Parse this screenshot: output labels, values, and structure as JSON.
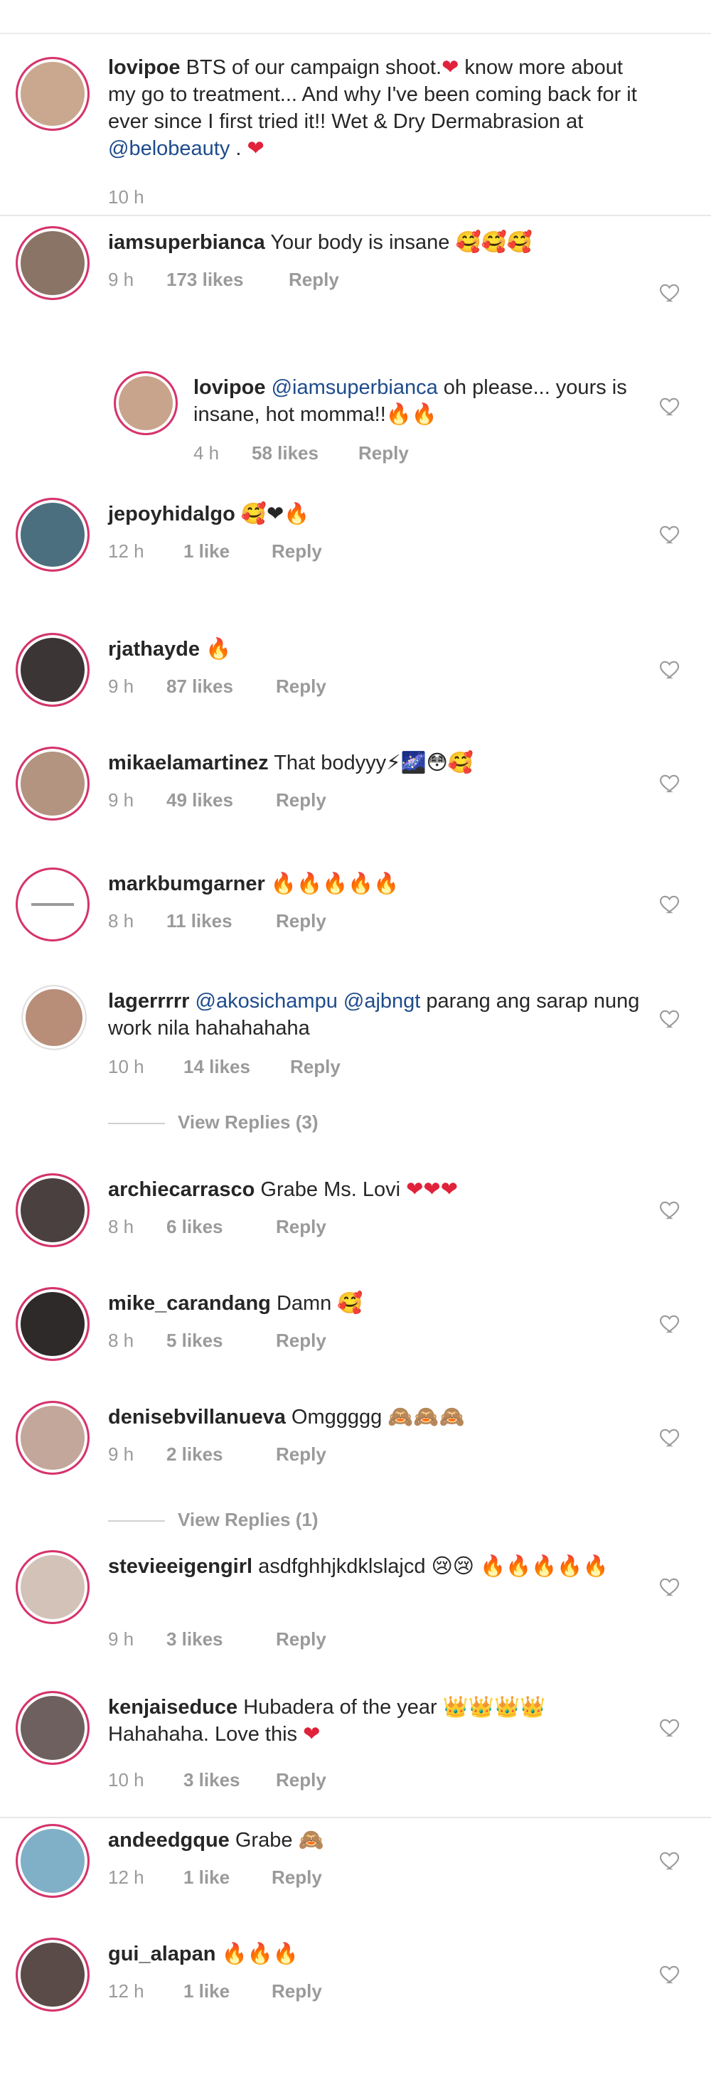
{
  "caption": {
    "username": "lovipoe",
    "text_before": "BTS of our campaign shoot.",
    "text_middle": " know more about my go to treatment... And why I've been coming back for it ever since I first tried it!! Wet & Dry Dermabrasion at ",
    "mention": "@belobeauty",
    "text_after": " . ",
    "time": "10 h",
    "heart": "❤"
  },
  "comments": [
    {
      "username": "iamsuperbianca",
      "text": " Your body is insane ",
      "emoji": "🥰🥰🥰",
      "time": "9 h",
      "likes": "173 likes",
      "reply": "Reply"
    },
    {
      "username": "lovipoe",
      "mention": "@iamsuperbianca",
      "text": " oh please... yours is insane, hot momma!!",
      "emoji": "🔥🔥",
      "time": "4 h",
      "likes": "58 likes",
      "reply": "Reply"
    },
    {
      "username": "jepoyhidalgo",
      "text": " ",
      "emoji": "🥰❤🔥",
      "time": "12 h",
      "likes": "1 like",
      "reply": "Reply"
    },
    {
      "username": "rjathayde",
      "text": " ",
      "emoji": "🔥",
      "time": "9 h",
      "likes": "87 likes",
      "reply": "Reply"
    },
    {
      "username": "mikaelamartinez",
      "text": " That bodyyy",
      "emoji": "⚡🌌😳🥰",
      "time": "9 h",
      "likes": "49 likes",
      "reply": "Reply"
    },
    {
      "username": "markbumgarner",
      "text": " ",
      "emoji": "🔥🔥🔥🔥🔥",
      "time": "8 h",
      "likes": "11 likes",
      "reply": "Reply"
    },
    {
      "username": "lagerrrrr",
      "mention": "@akosichampu @ajbngt",
      "text": " parang ang sarap nung work nila hahahahaha",
      "emoji": "",
      "time": "10 h",
      "likes": "14 likes",
      "reply": "Reply",
      "view_replies": "View Replies (3)"
    },
    {
      "username": "archiecarrasco",
      "text": " Grabe Ms. Lovi ",
      "emoji": "❤❤❤",
      "time": "8 h",
      "likes": "6 likes",
      "reply": "Reply"
    },
    {
      "username": "mike_carandang",
      "text": " Damn ",
      "emoji": "🥰",
      "time": "8 h",
      "likes": "5 likes",
      "reply": "Reply"
    },
    {
      "username": "denisebvillanueva",
      "text": " Omggggg ",
      "emoji": "🙈🙈🙈",
      "time": "9 h",
      "likes": "2 likes",
      "reply": "Reply",
      "view_replies": "View Replies (1)"
    },
    {
      "username": "stevieeigengirl",
      "text": " asdfghhjkdklslajcd ",
      "emoji": "😢😢 🔥🔥🔥🔥🔥",
      "time": "9 h",
      "likes": "3 likes",
      "reply": "Reply"
    },
    {
      "username": "kenjaiseduce",
      "text": " Hubadera of the year ",
      "emoji": "👑👑👑👑",
      "text2": "Hahahaha. Love this ",
      "emoji2": "❤",
      "time": "10 h",
      "likes": "3 likes",
      "reply": "Reply"
    },
    {
      "username": "andeedgque",
      "text": " Grabe ",
      "emoji": "🙈",
      "time": "12 h",
      "likes": "1 like",
      "reply": "Reply"
    },
    {
      "username": "gui_alapan",
      "text": " ",
      "emoji": "🔥🔥🔥",
      "time": "12 h",
      "likes": "1 like",
      "reply": "Reply"
    }
  ],
  "colors": {
    "accent_heart": "#e0223a",
    "mention": "#1e4b8c",
    "story_ring": "#d6336c"
  },
  "icons": {
    "like": "heart-outline-icon"
  }
}
